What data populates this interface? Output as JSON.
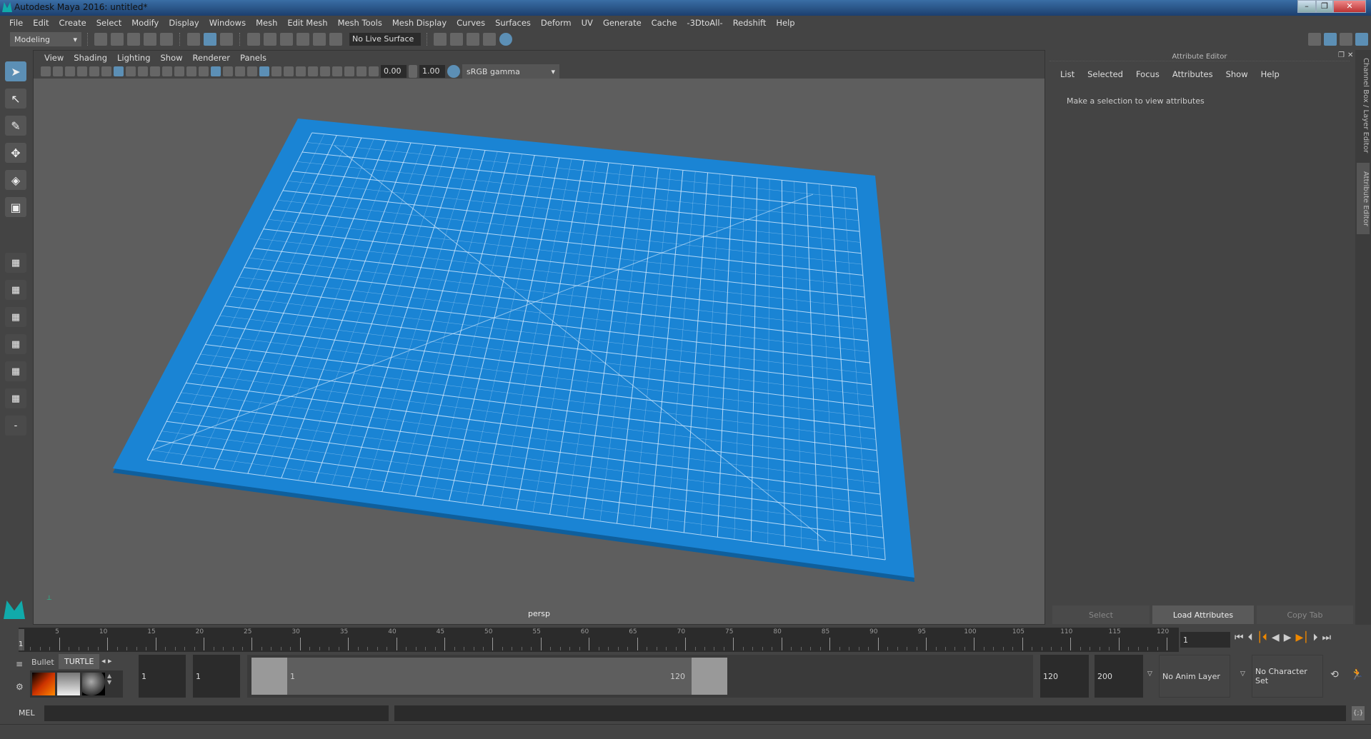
{
  "app": {
    "title": "Autodesk Maya 2016: untitled*"
  },
  "window_controls": {
    "minimize": "–",
    "restore": "❐",
    "close": "✕"
  },
  "menubar": [
    "File",
    "Edit",
    "Create",
    "Select",
    "Modify",
    "Display",
    "Windows",
    "Mesh",
    "Edit Mesh",
    "Mesh Tools",
    "Mesh Display",
    "Curves",
    "Surfaces",
    "Deform",
    "UV",
    "Generate",
    "Cache",
    "-3DtoAll-",
    "Redshift",
    "Help"
  ],
  "toolbar": {
    "mode": "Modeling",
    "live_surface": "No Live Surface",
    "icons": [
      "new-scene-icon",
      "open-scene-icon",
      "save-scene-icon",
      "undo-icon",
      "redo-icon",
      "|",
      "select-by-hierarchy-icon",
      "select-by-object-icon",
      "select-by-component-icon",
      "|",
      "snap-grid-icon",
      "snap-curve-icon",
      "snap-point-icon",
      "snap-view-icon",
      "snap-surface-icon",
      "snap-live-icon"
    ],
    "render_icons": [
      "render-view-icon",
      "render-frame-icon",
      "ipr-render-icon",
      "render-settings-icon",
      "hypershade-icon"
    ],
    "right_icons": [
      "modeling-toolkit-icon",
      "attribute-editor-toggle-icon",
      "tool-settings-icon",
      "channel-box-icon"
    ]
  },
  "viewport": {
    "menu": [
      "View",
      "Shading",
      "Lighting",
      "Show",
      "Renderer",
      "Panels"
    ],
    "exposure": "0.00",
    "gamma": "1.00",
    "color_space": "sRGB gamma",
    "camera_label": "persp",
    "mat_color": "#1a84d4",
    "mat_line_color": "#d8ecff",
    "bg_color": "#5e5e5e"
  },
  "toolbox": [
    "select-tool-icon",
    "lasso-tool-icon",
    "paint-select-icon",
    "move-tool-icon",
    "rotate-tool-icon",
    "scale-tool-icon",
    "layout-single-icon",
    "layout-four-icon",
    "layout-two-icon",
    "layout-outliner-icon",
    "layout-graph-icon",
    "layout-hypershade-icon",
    "layout-minus-icon"
  ],
  "attribute_editor": {
    "title": "Attribute Editor",
    "menu": [
      "List",
      "Selected",
      "Focus",
      "Attributes",
      "Show",
      "Help"
    ],
    "message": "Make a selection to view attributes",
    "buttons": {
      "select": "Select",
      "load": "Load Attributes",
      "copy": "Copy Tab"
    }
  },
  "side_tabs": {
    "channel_box": "Channel Box / Layer Editor",
    "attribute_editor": "Attribute Editor"
  },
  "timeline": {
    "start": 1,
    "end": 120,
    "current_frame": "1",
    "ticks": [
      "5",
      "10",
      "15",
      "20",
      "25",
      "30",
      "35",
      "40",
      "45",
      "50",
      "55",
      "60",
      "65",
      "70",
      "75",
      "80",
      "85",
      "90",
      "95",
      "100",
      "105",
      "110",
      "115",
      "120"
    ],
    "first": "1"
  },
  "shelf": {
    "tabs": [
      "Bullet",
      "TURTLE"
    ]
  },
  "range": {
    "start": "1",
    "anim_start": "1",
    "slider_start": "1",
    "slider_end": "120",
    "anim_end": "120",
    "end": "200",
    "anim_layer": "No Anim Layer",
    "character_set": "No Character Set"
  },
  "command_line": {
    "language": "MEL"
  },
  "accent": "#5c8fb5"
}
